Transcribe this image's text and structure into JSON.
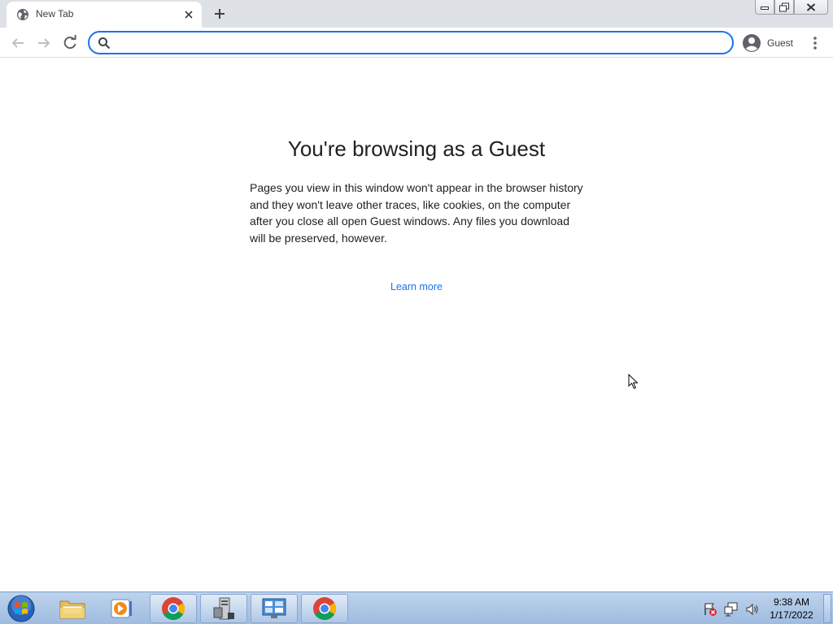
{
  "tab": {
    "title": "New Tab",
    "icon": "globe-icon"
  },
  "toolbar": {
    "address": {
      "value": "",
      "placeholder": ""
    },
    "profile_label": "Guest"
  },
  "content": {
    "heading": "You're browsing as a Guest",
    "description": "Pages you view in this window won't appear in the browser history and they won't leave other traces, like cookies, on the computer after you close all open Guest windows. Any files you download will be preserved, however.",
    "learn_more": "Learn more"
  },
  "taskbar": {
    "items": [
      {
        "name": "windows-explorer",
        "icon": "folder-icon",
        "active": false
      },
      {
        "name": "media-player",
        "icon": "media-player-icon",
        "active": false
      },
      {
        "name": "chrome-1",
        "icon": "chrome-icon",
        "active": true
      },
      {
        "name": "server-manager",
        "icon": "server-icon",
        "active": true
      },
      {
        "name": "control-panel",
        "icon": "control-panel-icon",
        "active": true
      },
      {
        "name": "chrome-2",
        "icon": "chrome-icon",
        "active": true
      }
    ],
    "clock": {
      "time": "9:38 AM",
      "date": "1/17/2022"
    }
  },
  "colors": {
    "accent": "#1a73e8",
    "tabstrip": "#dee1e6",
    "taskbar": "#a9c3e6"
  }
}
